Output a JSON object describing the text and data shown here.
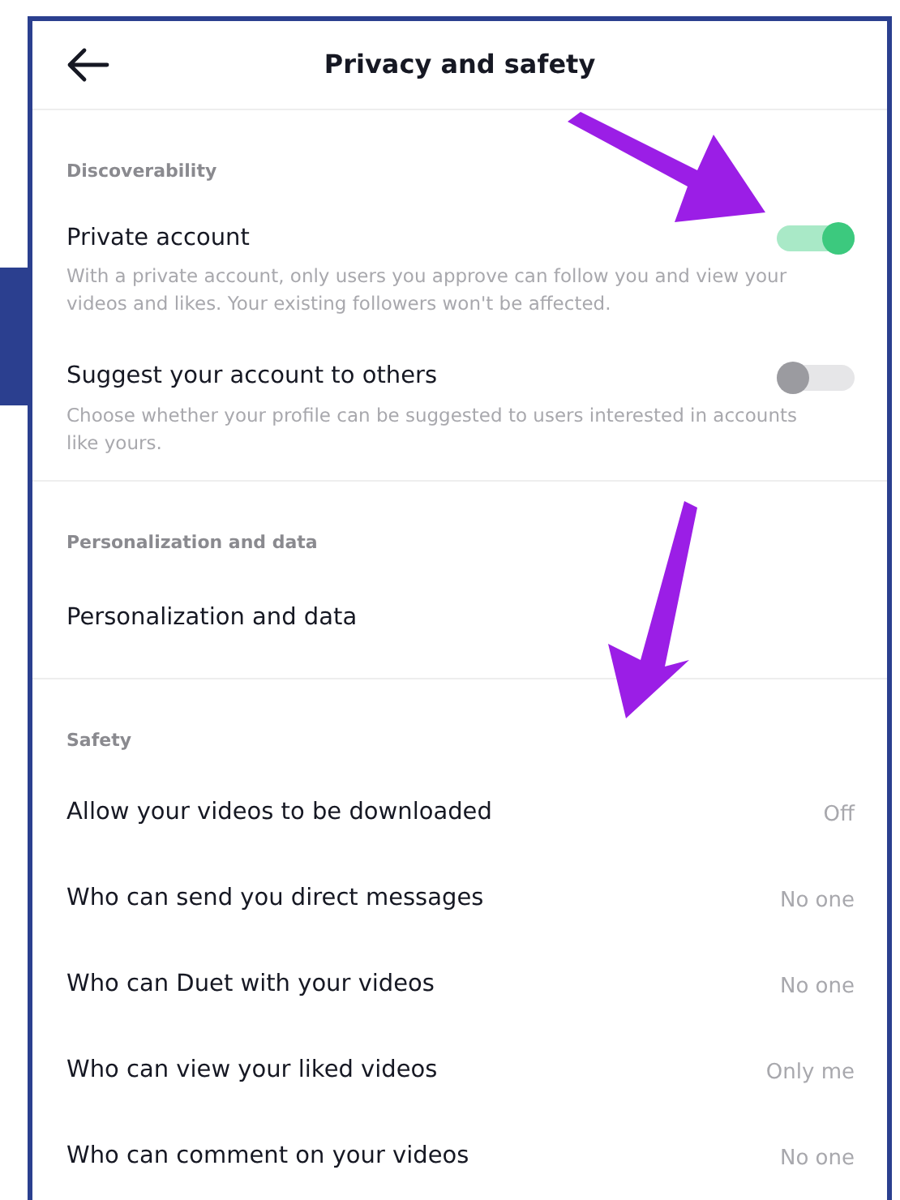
{
  "header": {
    "title": "Privacy and safety"
  },
  "sections": [
    {
      "label": "Discoverability",
      "items": [
        {
          "kind": "toggle",
          "title": "Private account",
          "description": "With a private account, only users you approve can follow you and view your videos and likes. Your existing followers won't be affected.",
          "on": true
        },
        {
          "kind": "toggle",
          "title": "Suggest your account to others",
          "description": "Choose whether your profile can be suggested to users interested in accounts like yours.",
          "on": false
        }
      ]
    },
    {
      "label": "Personalization and data",
      "items": [
        {
          "kind": "link",
          "title": "Personalization and data"
        }
      ]
    },
    {
      "label": "Safety",
      "items": [
        {
          "kind": "value",
          "title": "Allow your videos to be downloaded",
          "value": "Off"
        },
        {
          "kind": "value",
          "title": "Who can send you direct messages",
          "value": "No one"
        },
        {
          "kind": "value",
          "title": "Who can Duet with your videos",
          "value": "No one"
        },
        {
          "kind": "value",
          "title": "Who can view your liked videos",
          "value": "Only me"
        },
        {
          "kind": "value",
          "title": "Who can comment on your videos",
          "value": "No one"
        }
      ]
    }
  ]
}
